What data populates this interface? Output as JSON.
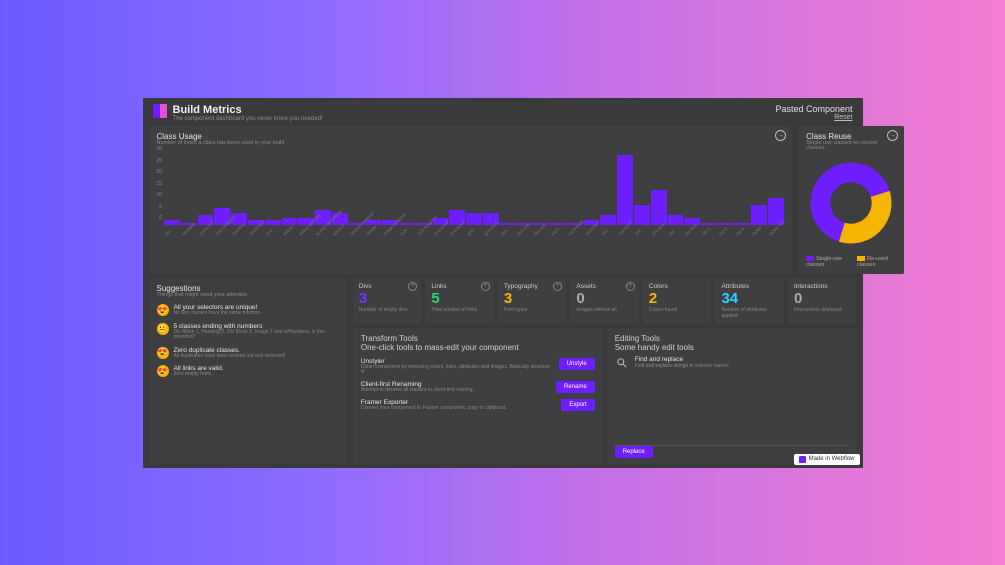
{
  "header": {
    "title": "Build Metrics",
    "sub": "The component dashboard you never knew you needed!",
    "right_title": "Pasted Component",
    "reset": "Reset"
  },
  "usage": {
    "title": "Class Usage",
    "sub": "Number of times a class has been used in your build"
  },
  "reuse": {
    "title": "Class Reuse",
    "sub": "Single use classes vs reused classes",
    "leg1": "Single-use classes",
    "leg2": "Re-used classes"
  },
  "suggestions": {
    "title": "Suggestions",
    "sub": "Things that might need your attention",
    "items": [
      {
        "t": "All your selectors are unique!",
        "d": "No two classes have the same function."
      },
      {
        "t": "5 classes ending with numbers",
        "d": "Div Block 1, Heading 2, Div Block 3, Image 2 and w/Numbers, is this intended?"
      },
      {
        "t": "Zero duplicate classes.",
        "d": "All duplicates have been worked out and removed!"
      },
      {
        "t": "All links are valid.",
        "d": "Zero empty hrefs."
      }
    ]
  },
  "metrics": [
    {
      "t": "Divs",
      "v": "3",
      "d": "Number of empty divs",
      "c": "c-purple",
      "plus": true
    },
    {
      "t": "Links",
      "v": "5",
      "d": "Total number of links",
      "c": "c-green",
      "plus": true
    },
    {
      "t": "Typography",
      "v": "3",
      "d": "Font types",
      "c": "c-yellow",
      "plus": true
    },
    {
      "t": "Assets",
      "v": "0",
      "d": "Images without alt",
      "c": "c-gray",
      "plus": true
    },
    {
      "t": "Colors",
      "v": "2",
      "d": "Colors found",
      "c": "c-yellow",
      "plus": false
    },
    {
      "t": "Attributes",
      "v": "34",
      "d": "Number of attributes applied",
      "c": "c-cyan",
      "plus": false
    },
    {
      "t": "Interactions",
      "v": "0",
      "d": "Interactions deployed",
      "c": "c-gray",
      "plus": false
    }
  ],
  "transform": {
    "title": "Transform Tools",
    "sub": "One-click tools to mass-edit your component",
    "items": [
      {
        "t": "Unstyler",
        "d": "Clean component by removing colors, links, attributes and images. Basically structure it!",
        "b": "Unstyle"
      },
      {
        "t": "Client-first Renaming",
        "d": "Attempt to rename all classes to client-first naming.",
        "b": "Rename"
      },
      {
        "t": "Framer Exporter",
        "d": "Convert your component to Framer component, copy to clipboard.",
        "b": "Export"
      }
    ]
  },
  "edit": {
    "title": "Editing Tools",
    "sub": "Some handy edit tools",
    "fr_title": "Find and replace",
    "fr_sub": "Find and replace strings in selector names",
    "replace": "Replace"
  },
  "badge": "Made in Webflow",
  "chart_data": {
    "type": "bar",
    "title": "Class Usage",
    "ylabel": "",
    "ylim": [
      0,
      30
    ],
    "yticks": [
      30,
      25,
      20,
      15,
      10,
      5,
      0
    ],
    "categories": [
      "div",
      "wrapper",
      "container",
      "hero-wrapper",
      "heading",
      "heading-2",
      "text",
      "button",
      "button-primary",
      "button-secondary",
      "section",
      "section-wrapper",
      "image",
      "image-wrapper",
      "icon",
      "icon-wrapper",
      "text-small",
      "text-block",
      "grid",
      "grid-item",
      "flex",
      "flex-row",
      "flex-col",
      "card",
      "card-body",
      "card-title",
      "nav",
      "nav-item",
      "link",
      "link-text",
      "list",
      "list-item",
      "list-1",
      "list-2",
      "list-3",
      "footer",
      "footer-link"
    ],
    "values": [
      2,
      1,
      4,
      7,
      5,
      2,
      2,
      3,
      3,
      6,
      5,
      1,
      2,
      2,
      1,
      1,
      3,
      6,
      5,
      5,
      1,
      1,
      1,
      1,
      1,
      2,
      4,
      28,
      8,
      14,
      4,
      3,
      1,
      1,
      1,
      8,
      11
    ]
  },
  "donut_data": {
    "type": "pie",
    "title": "Class Reuse",
    "series": [
      {
        "name": "Single-use classes",
        "value": 65
      },
      {
        "name": "Re-used classes",
        "value": 35
      }
    ]
  }
}
